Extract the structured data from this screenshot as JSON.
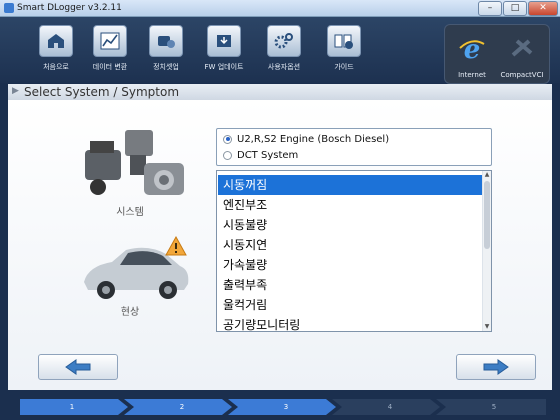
{
  "window": {
    "title": "Smart DLogger v3.2.11"
  },
  "toolbar": {
    "items": [
      {
        "label": "처음으로",
        "icon": "home-icon"
      },
      {
        "label": "데이터 변환",
        "icon": "data-convert-icon"
      },
      {
        "label": "정치셋업",
        "icon": "device-setup-icon"
      },
      {
        "label": "FW 업데이트",
        "icon": "firmware-update-icon"
      },
      {
        "label": "사용자옵션",
        "icon": "user-options-icon"
      },
      {
        "label": "가이드",
        "icon": "guide-icon"
      }
    ],
    "connection": [
      {
        "label": "Internet",
        "icon": "internet-explorer-icon"
      },
      {
        "label": "CompactVCI",
        "icon": "compactvci-icon"
      }
    ]
  },
  "header": {
    "title": "Select System / Symptom"
  },
  "system_caption": "시스템",
  "symptom_caption": "현상",
  "systems": {
    "options": [
      "U2,R,S2 Engine (Bosch Diesel)",
      "DCT System"
    ],
    "selected_index": 0
  },
  "symptoms": {
    "items": [
      "시동꺼짐",
      "엔진부조",
      "시동불량",
      "시동지연",
      "가속불량",
      "출력부족",
      "울컥거림",
      "공기량모니터링"
    ],
    "selected_index": 0
  },
  "steps": [
    "1",
    "2",
    "3",
    "4",
    "5"
  ],
  "colors": {
    "accent": "#1c72d8",
    "toolbar_bg": "#22395a",
    "steps_active": "#3c7bd6"
  }
}
